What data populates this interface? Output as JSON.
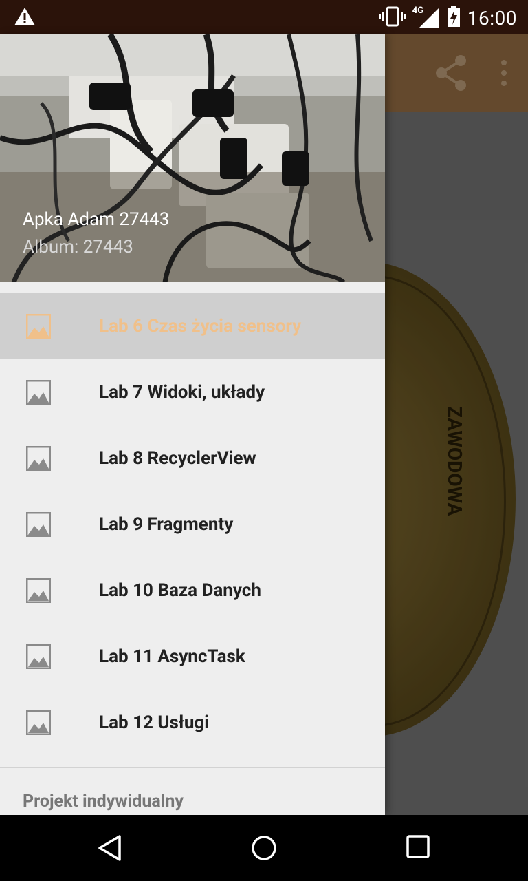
{
  "status_bar": {
    "time": "16:00",
    "network": "4G",
    "icons": [
      "warning-icon",
      "vibrate-icon",
      "signal-icon",
      "battery-charging-icon"
    ]
  },
  "app_bar": {
    "actions": [
      "share-icon",
      "overflow-menu-icon"
    ]
  },
  "drawer": {
    "header": {
      "title": "Apka Adam 27443",
      "subtitle": "Album: 27443"
    },
    "items": [
      {
        "label": "Lab 6 Czas życia sensory",
        "icon": "image-icon",
        "selected": true
      },
      {
        "label": "Lab 7 Widoki, układy",
        "icon": "image-icon",
        "selected": false
      },
      {
        "label": "Lab 8 RecyclerView",
        "icon": "image-icon",
        "selected": false
      },
      {
        "label": "Lab 9 Fragmenty",
        "icon": "image-icon",
        "selected": false
      },
      {
        "label": "Lab 10 Baza Danych",
        "icon": "image-icon",
        "selected": false
      },
      {
        "label": "Lab 11 AsyncTask",
        "icon": "image-icon",
        "selected": false
      },
      {
        "label": "Lab 12 Usługi",
        "icon": "image-icon",
        "selected": false
      }
    ],
    "section_header": "Projekt indywidualny"
  },
  "background_image": {
    "coin_text": "ZAWODOWA"
  },
  "colors": {
    "accent": "#f0c08a",
    "status_bar": "#2b130a",
    "app_bar": "#7a5a38",
    "drawer_bg": "#eeeeee",
    "selected_bg": "#cfcfcf"
  },
  "nav_bar": {
    "buttons": [
      "back-icon",
      "home-icon",
      "recents-icon"
    ]
  }
}
